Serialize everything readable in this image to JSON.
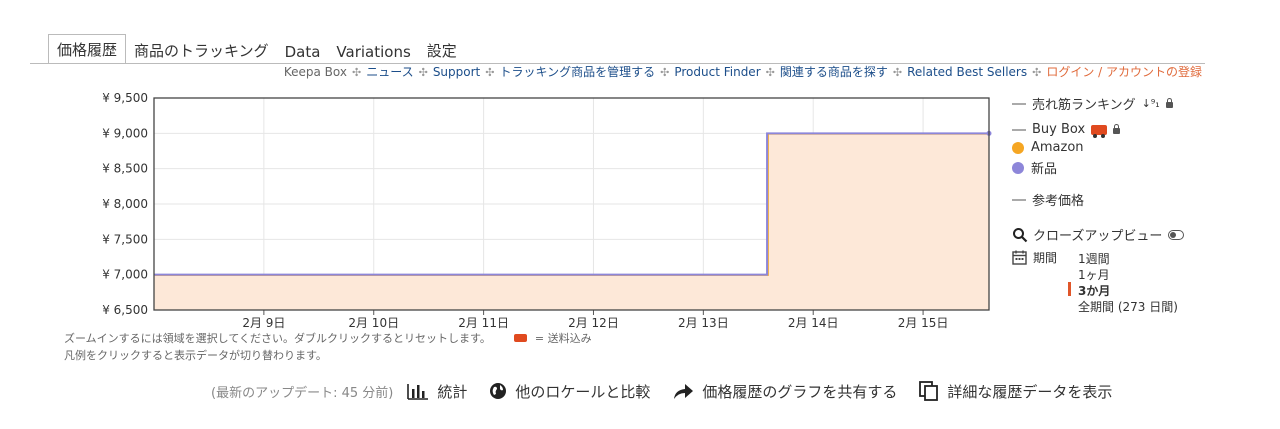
{
  "tabs": [
    {
      "label": "価格履歴",
      "active": true
    },
    {
      "label": "商品のトラッキング"
    },
    {
      "label": "Data"
    },
    {
      "label": "Variations"
    },
    {
      "label": "設定"
    }
  ],
  "links": {
    "keepa_box": "Keepa Box",
    "news": "ニュース",
    "support": "Support",
    "manage": "トラッキング商品を管理する",
    "finder": "Product Finder",
    "related_find": "関連する商品を探す",
    "best_sellers": "Related Best Sellers",
    "login": "ログイン / アカウントの登録"
  },
  "chart_data": {
    "type": "line",
    "yaxis": {
      "min": 6500,
      "max": 9500,
      "ticks": [
        "¥ 6,500",
        "¥ 7,000",
        "¥ 7,500",
        "¥ 8,000",
        "¥ 8,500",
        "¥ 9,000",
        "¥ 9,500"
      ],
      "tick_values": [
        6500,
        7000,
        7500,
        8000,
        8500,
        9000,
        9500
      ]
    },
    "xaxis": {
      "ticks": [
        "2月 9日",
        "2月 10日",
        "2月 11日",
        "2月 12日",
        "2月 13日",
        "2月 14日",
        "2月 15日"
      ],
      "range_days": [
        8.0,
        15.6
      ]
    },
    "grid": true,
    "series": [
      {
        "name": "Amazon",
        "color": "#f5a623",
        "fill": "#fde8d8",
        "points": [
          [
            8.0,
            7000
          ],
          [
            13.58,
            7000
          ],
          [
            13.58,
            9000
          ],
          [
            15.6,
            9000
          ]
        ]
      },
      {
        "name": "新品",
        "color": "#8d86d9",
        "points": [
          [
            8.0,
            7000
          ],
          [
            13.58,
            7000
          ],
          [
            13.58,
            9000
          ],
          [
            15.6,
            9000
          ]
        ]
      }
    ]
  },
  "legend": {
    "sales_rank": "売れ筋ランキング",
    "buy_box": "Buy Box",
    "amazon": "Amazon",
    "amazon_color": "#f5a623",
    "new": "新品",
    "new_color": "#8d86d9",
    "reference_price": "参考価格",
    "closeup": "クローズアップビュー",
    "period_label": "期間",
    "ranges": [
      "1週間",
      "1ヶ月",
      "3か月",
      "全期間 (273 日間)"
    ],
    "selected_range": "3か月"
  },
  "hints": {
    "zoom": "ズームインするには領域を選択してください。ダブルクリックするとリセットします。",
    "shipping": "= 送料込み",
    "legend_click": "凡例をクリックすると表示データが切り替わります。"
  },
  "footer": {
    "updated": "(最新のアップデート: 45 分前)",
    "stats": "統計",
    "compare": "他のロケールと比較",
    "share": "価格履歴のグラフを共有する",
    "details": "詳細な履歴データを表示"
  }
}
